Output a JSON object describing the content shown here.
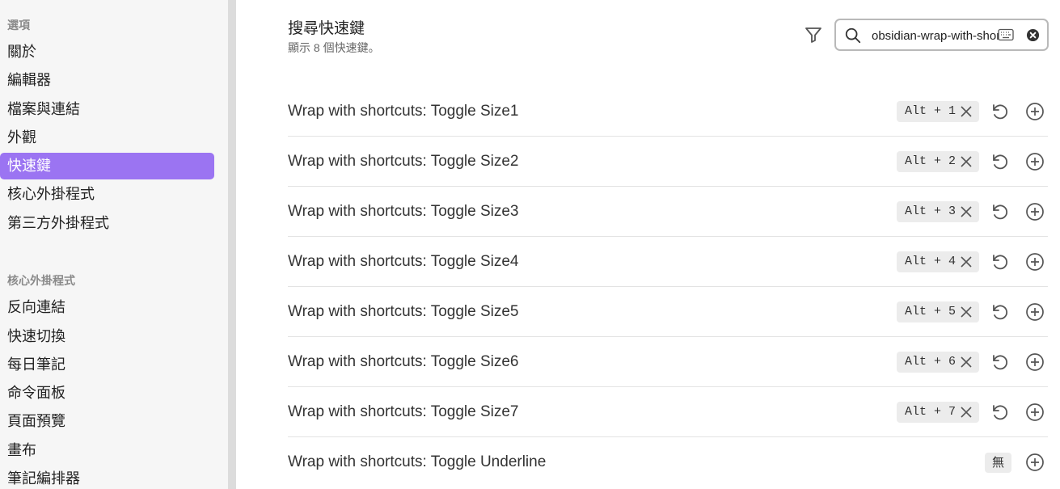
{
  "sidebar": {
    "sections": [
      {
        "title": "選項",
        "items": [
          "關於",
          "編輯器",
          "檔案與連結",
          "外觀",
          "快速鍵",
          "核心外掛程式",
          "第三方外掛程式"
        ],
        "active_index": 4
      },
      {
        "title": "核心外掛程式",
        "items": [
          "反向連結",
          "快速切換",
          "每日筆記",
          "命令面板",
          "頁面預覽",
          "畫布",
          "筆記編排器"
        ]
      }
    ]
  },
  "header": {
    "title": "搜尋快速鍵",
    "subtitle": "顯示 8 個快速鍵。"
  },
  "search": {
    "value": "obsidian-wrap-with-short",
    "icons": [
      "filter-icon",
      "search-icon",
      "keyboard-icon",
      "clear-icon"
    ]
  },
  "hotkeys": [
    {
      "label": "Wrap with shortcuts: Toggle Size1",
      "key": "Alt + 1"
    },
    {
      "label": "Wrap with shortcuts: Toggle Size2",
      "key": "Alt + 2"
    },
    {
      "label": "Wrap with shortcuts: Toggle Size3",
      "key": "Alt + 3"
    },
    {
      "label": "Wrap with shortcuts: Toggle Size4",
      "key": "Alt + 4"
    },
    {
      "label": "Wrap with shortcuts: Toggle Size5",
      "key": "Alt + 5"
    },
    {
      "label": "Wrap with shortcuts: Toggle Size6",
      "key": "Alt + 6"
    },
    {
      "label": "Wrap with shortcuts: Toggle Size7",
      "key": "Alt + 7"
    },
    {
      "label": "Wrap with shortcuts: Toggle Underline",
      "key": null,
      "none_label": "無"
    }
  ],
  "colors": {
    "accent": "#9b74f2",
    "sidebar_bg": "#f6f6f6",
    "badge_bg": "#ececec"
  }
}
